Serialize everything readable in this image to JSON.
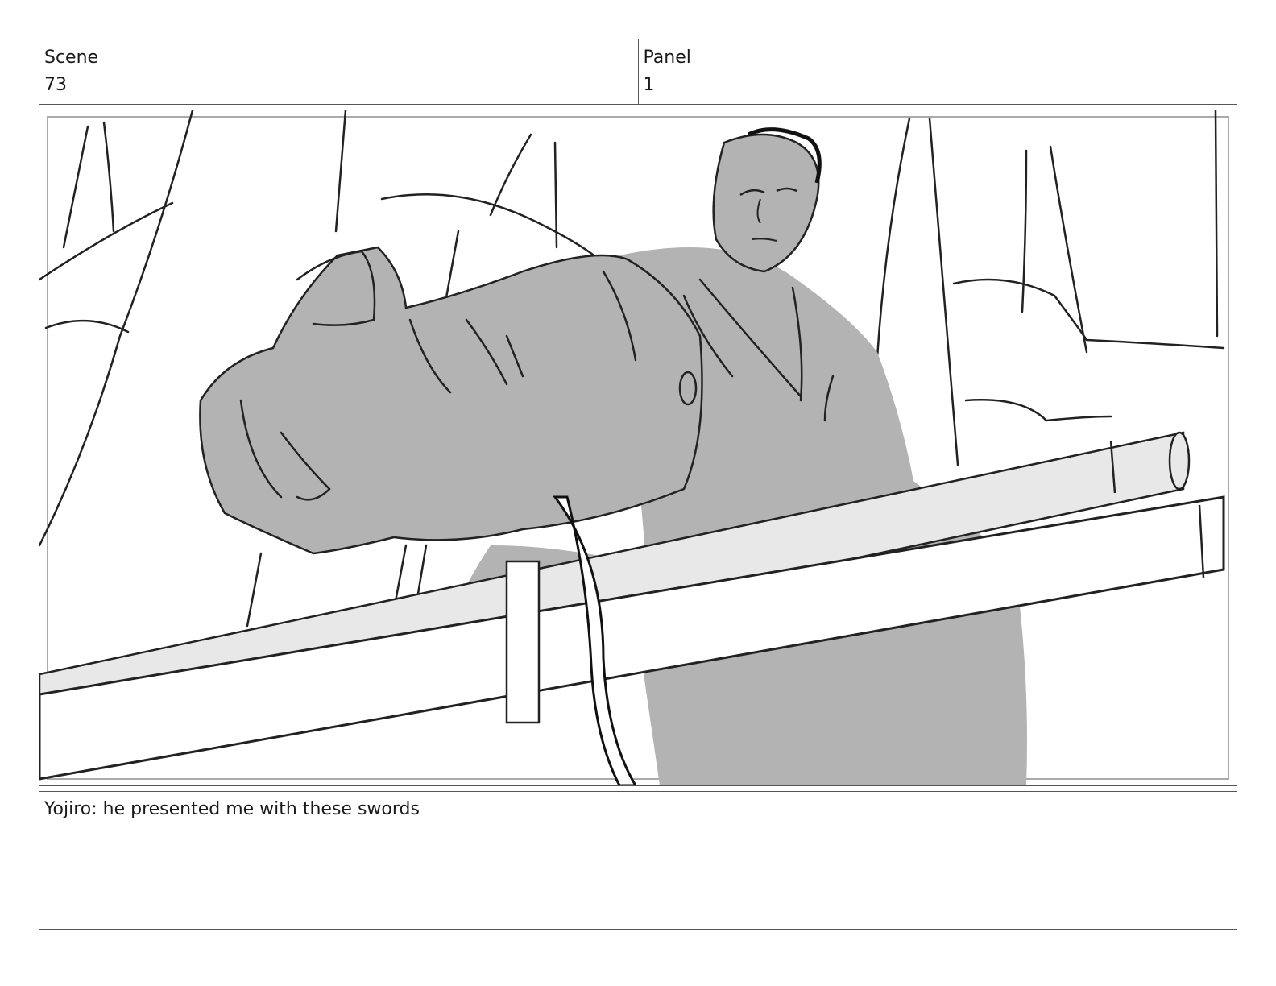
{
  "header": {
    "scene_label": "Scene",
    "scene_value": "73",
    "panel_label": "Panel",
    "panel_value": "1"
  },
  "frame": {
    "description_icon": "storyboard-sketch-image"
  },
  "dialogue": {
    "text": "Yojiro: he presented me with these swords"
  }
}
